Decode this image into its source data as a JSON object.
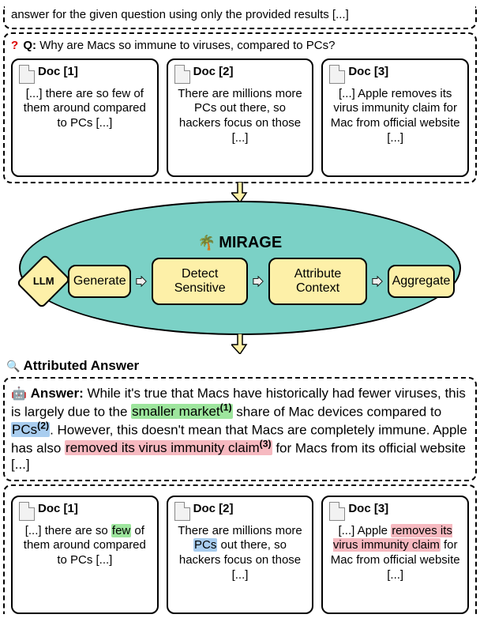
{
  "top_clipped_text": "answer for the given question using only the provided results [...]",
  "question": {
    "prefix": "Q:",
    "text": "Why are Macs so immune to viruses, compared to PCs?"
  },
  "docs_top": [
    {
      "title": "Doc [1]",
      "text": "[...] there are so few of them around compared to PCs [...]"
    },
    {
      "title": "Doc [2]",
      "text": "There are millions more PCs out there, so hackers focus on those [...]"
    },
    {
      "title": "Doc [3]",
      "text": "[...] Apple removes its virus immunity claim for Mac from official website [...]"
    }
  ],
  "mirage": {
    "title": "MIRAGE",
    "llm_label": "LLM",
    "steps": [
      "Generate",
      "Detect Sensitive",
      "Attribute Context",
      "Aggregate"
    ]
  },
  "attributed_label": "Attributed Answer",
  "answer": {
    "label": "Answer:",
    "pre1": "While it's true that Macs have historically had fewer viruses, this is largely due to the ",
    "hl1": "smaller market",
    "sup1": "(1)",
    "mid1": " share of Mac devices compared to ",
    "hl2": "PCs",
    "sup2": "(2)",
    "mid2": ". However, this doesn't mean that Macs are completely immune. Apple has also ",
    "hl3": "removed its virus immunity claim",
    "sup3": "(3)",
    "post": " for Macs from its official website [...]"
  },
  "docs_bottom": [
    {
      "title": "Doc [1]",
      "pre": "[...] there are so ",
      "hl": "few",
      "post": " of them around compared to PCs [...]",
      "hlClass": "hl-green"
    },
    {
      "title": "Doc [2]",
      "pre": "There are millions more ",
      "hl": "PCs",
      "post": " out there, so hackers focus on those [...]",
      "hlClass": "hl-blue"
    },
    {
      "title": "Doc [3]",
      "pre": "[...] Apple ",
      "hl": "removes its virus immunity claim",
      "post": " for Mac from official website [...]",
      "hlClass": "hl-pink"
    }
  ]
}
